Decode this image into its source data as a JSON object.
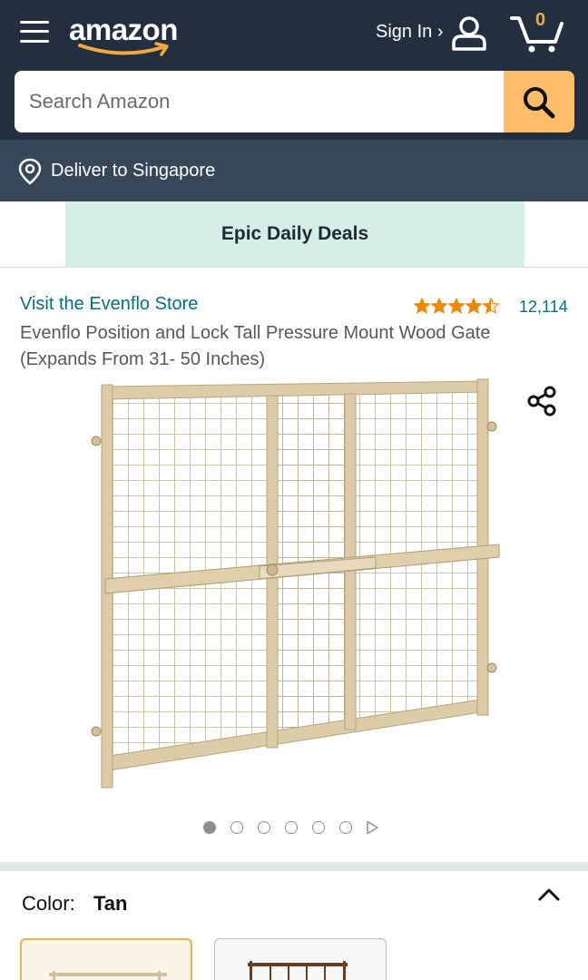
{
  "header": {
    "logo_text": "amazon",
    "signin_label": "Sign In ›",
    "cart_count": "0"
  },
  "search": {
    "placeholder": "Search Amazon"
  },
  "deliver": {
    "label": "Deliver to Singapore"
  },
  "promo": {
    "label": "Epic Daily Deals"
  },
  "product": {
    "store_link": "Visit the Evenflo Store",
    "rating": 4.5,
    "rating_count": "12,114",
    "title": "Evenflo Position and Lock Tall Pressure Mount Wood Gate (Expands From 31- 50 Inches)",
    "image_count": 6,
    "active_image": 1
  },
  "color": {
    "label": "Color:",
    "value": "Tan"
  },
  "colors": {
    "brand_dark": "#232f3e",
    "deliver_bg": "#37475a",
    "search_button": "#febd69",
    "cart_badge": "#f3a847",
    "link": "#007185",
    "deals_bg": "#d5eee7",
    "star": "#f08804"
  },
  "icons": {
    "menu": "hamburger-icon",
    "user": "user-icon",
    "cart": "cart-icon",
    "search": "search-icon",
    "location": "location-pin-icon",
    "share": "share-icon",
    "next": "play-next-icon",
    "collapse": "chevron-up-icon"
  }
}
